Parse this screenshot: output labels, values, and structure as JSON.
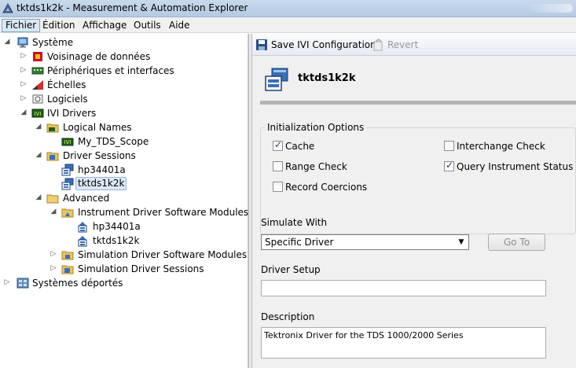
{
  "window": {
    "title": "tktds1k2k - Measurement & Automation Explorer"
  },
  "menu": [
    "Fichier",
    "Édition",
    "Affichage",
    "Outils",
    "Aide"
  ],
  "tree": {
    "items": [
      {
        "label": "Système",
        "icon": "computer-icon"
      },
      {
        "label": "Voisinage de données",
        "icon": "data-neighborhood-icon"
      },
      {
        "label": "Périphériques et interfaces",
        "icon": "devices-icon"
      },
      {
        "label": "Échelles",
        "icon": "scales-icon"
      },
      {
        "label": "Logiciels",
        "icon": "software-icon"
      },
      {
        "label": "IVI Drivers",
        "icon": "ivi-icon"
      },
      {
        "label": "Logical Names",
        "icon": "folder-icon"
      },
      {
        "label": "My_TDS_Scope",
        "icon": "ivi-icon"
      },
      {
        "label": "Driver Sessions",
        "icon": "folder-icon"
      },
      {
        "label": "hp34401a",
        "icon": "session-icon"
      },
      {
        "label": "tktds1k2k",
        "icon": "session-icon"
      },
      {
        "label": "Advanced",
        "icon": "folder-icon"
      },
      {
        "label": "Instrument Driver Software Modules",
        "icon": "folder-icon"
      },
      {
        "label": "hp34401a",
        "icon": "module-icon"
      },
      {
        "label": "tktds1k2k",
        "icon": "module-icon"
      },
      {
        "label": "Simulation Driver Software Modules",
        "icon": "folder-icon"
      },
      {
        "label": "Simulation Driver Sessions",
        "icon": "folder-icon"
      },
      {
        "label": "Systèmes déportés",
        "icon": "remote-systems-icon"
      }
    ],
    "selected": "tktds1k2k"
  },
  "toolbar": {
    "save_label": "Save IVI Configuration",
    "revert_label": "Revert"
  },
  "header": {
    "title": "tktds1k2k"
  },
  "init_options": {
    "title": "Initialization Options",
    "cache": {
      "label": "Cache",
      "checked": true
    },
    "interchange_check": {
      "label": "Interchange Check",
      "checked": false
    },
    "range_check": {
      "label": "Range Check",
      "checked": false
    },
    "query_instrument_status": {
      "label": "Query Instrument Status",
      "checked": true
    },
    "record_coercions": {
      "label": "Record Coercions",
      "checked": false
    }
  },
  "simulate": {
    "label": "Simulate With",
    "value": "Specific Driver",
    "goto_label": "Go To"
  },
  "driver_setup": {
    "label": "Driver Setup",
    "value": ""
  },
  "description": {
    "label": "Description",
    "value": "Tektronix Driver for the TDS 1000/2000 Series"
  }
}
